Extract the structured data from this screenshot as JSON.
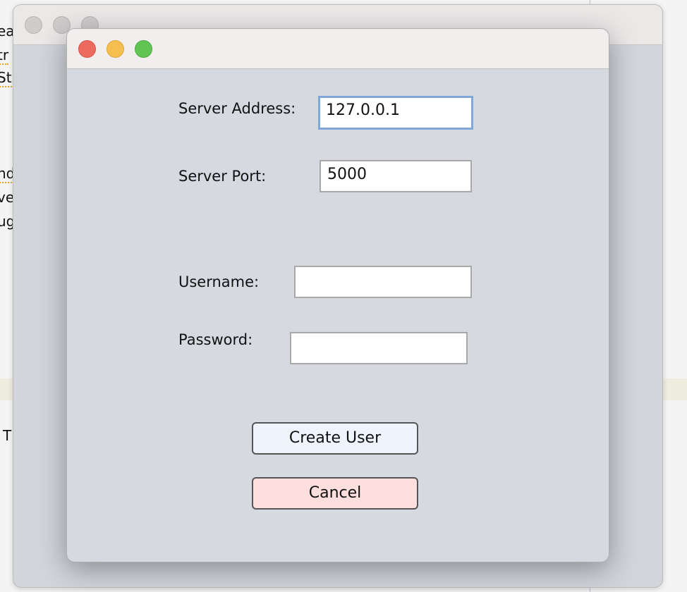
{
  "background": {
    "text_fragments": [
      "ea",
      "tr",
      "St",
      "nd",
      "ve",
      "ug",
      "T"
    ]
  },
  "dialog": {
    "fields": {
      "server_address": {
        "label": "Server Address:",
        "value": "127.0.0.1"
      },
      "server_port": {
        "label": "Server Port:",
        "value": "5000"
      },
      "username": {
        "label": "Username:",
        "value": ""
      },
      "password": {
        "label": "Password:",
        "value": ""
      }
    },
    "buttons": {
      "create_user": "Create User",
      "cancel": "Cancel"
    }
  },
  "colors": {
    "close": "#ec6a5e",
    "minimize": "#f4bf4f",
    "zoom": "#61c554",
    "create_bg": "#eef4fd",
    "cancel_bg": "#ffdede"
  }
}
